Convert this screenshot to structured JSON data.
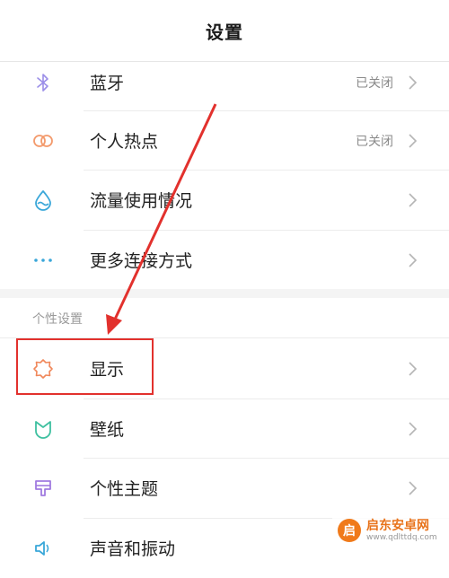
{
  "header": {
    "title": "设置"
  },
  "connection_items": [
    {
      "label": "蓝牙",
      "status": "已关闭",
      "icon": "bluetooth-icon"
    },
    {
      "label": "个人热点",
      "status": "已关闭",
      "icon": "hotspot-icon"
    },
    {
      "label": "流量使用情况",
      "status": "",
      "icon": "data-usage-icon"
    },
    {
      "label": "更多连接方式",
      "status": "",
      "icon": "more-connections-icon"
    }
  ],
  "personalization": {
    "section_title": "个性设置",
    "items": [
      {
        "label": "显示",
        "icon": "display-icon"
      },
      {
        "label": "壁纸",
        "icon": "wallpaper-icon"
      },
      {
        "label": "个性主题",
        "icon": "theme-icon"
      },
      {
        "label": "声音和振动",
        "icon": "sound-icon"
      }
    ]
  },
  "annotation": {
    "highlight_color": "#e2312d"
  },
  "watermark": {
    "name": "启东安卓网",
    "url": "www.qdlttdq.com"
  },
  "colors": {
    "bluetooth": "#9b8ee8",
    "hotspot": "#f39a6c",
    "data_usage": "#3aa7d9",
    "more": "#3aa7d9",
    "display": "#f0875a",
    "wallpaper": "#3fc0a0",
    "theme": "#a17be0",
    "sound": "#3aa7d9"
  }
}
